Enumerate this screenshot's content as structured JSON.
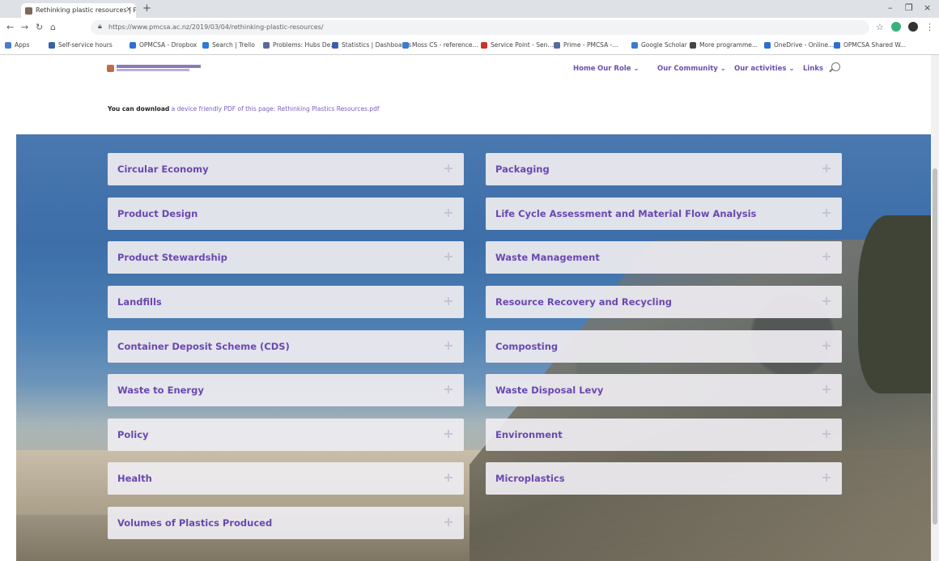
{
  "browser": {
    "tab_title": "Rethinking plastic resources | PMC",
    "url": "https://www.pmcsa.ac.nz/2019/03/04/rethinking-plastic-resources/",
    "bookmarks": [
      "Apps",
      "Self-service hours",
      "OPMCSA - Dropbox",
      "Search | Trello",
      "Problems: Hubs De...",
      "Statistics | Dashboards",
      "Moss CS - reference...",
      "Service Point - Sen...",
      "Prime - PMCSA -...",
      "Google Scholar",
      "More programme...",
      "OneDrive - Online...",
      "OPMCSA Shared W..."
    ]
  },
  "site": {
    "nav": [
      "Home",
      "Our Role ⌄",
      "Our Community ⌄",
      "Our activities ⌄",
      "Links"
    ],
    "download_prefix": "You can download",
    "download_link": "a device friendly PDF of this page: Rethinking Plastics Resources.pdf"
  },
  "accordion": {
    "left": [
      "Circular Economy",
      "Product Design",
      "Product Stewardship",
      "Landfills",
      "Container Deposit Scheme (CDS)",
      "Waste to Energy",
      "Policy",
      "Health",
      "Volumes of Plastics Produced"
    ],
    "right": [
      "Packaging",
      "Life Cycle Assessment and Material Flow Analysis",
      "Waste Management",
      "Resource Recovery and Recycling",
      "Composting",
      "Waste Disposal Levy",
      "Environment",
      "Microplastics"
    ]
  }
}
